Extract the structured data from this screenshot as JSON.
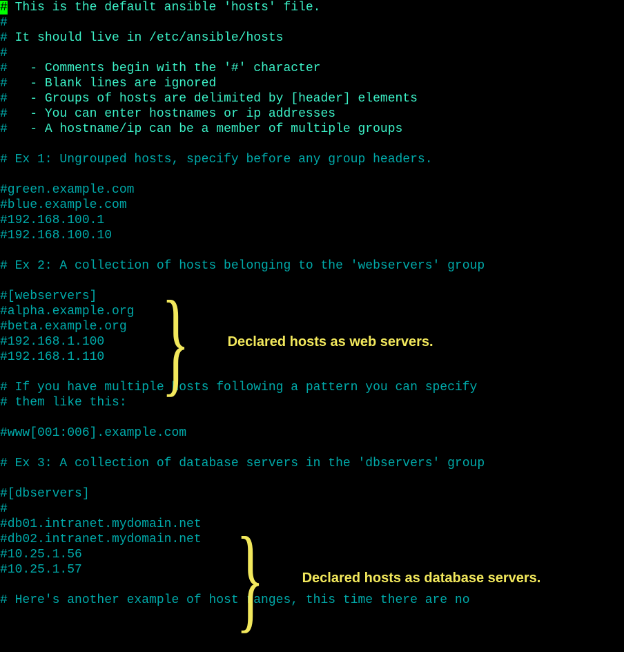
{
  "lines": [
    {
      "cursor": "#",
      "bright": " This is the default ansible 'hosts' file."
    },
    {
      "dim": "#"
    },
    {
      "dim": "#",
      "bright": " It should live in /etc/ansible/hosts"
    },
    {
      "dim": "#"
    },
    {
      "dim": "#",
      "bright": "   - Comments begin with the '#' character"
    },
    {
      "dim": "#",
      "bright": "   - Blank lines are ignored"
    },
    {
      "dim": "#",
      "bright": "   - Groups of hosts are delimited by [header] elements"
    },
    {
      "dim": "#",
      "bright": "   - You can enter hostnames or ip addresses"
    },
    {
      "dim": "#",
      "bright": "   - A hostname/ip can be a member of multiple groups"
    },
    {
      "blank": true
    },
    {
      "dim": "# Ex 1: Ungrouped hosts, specify before any group headers."
    },
    {
      "blank": true
    },
    {
      "dim": "#green.example.com"
    },
    {
      "dim": "#blue.example.com"
    },
    {
      "dim": "#192.168.100.1"
    },
    {
      "dim": "#192.168.100.10"
    },
    {
      "blank": true
    },
    {
      "dim": "# Ex 2: A collection of hosts belonging to the 'webservers' group"
    },
    {
      "blank": true
    },
    {
      "dim": "#[webservers]"
    },
    {
      "dim": "#alpha.example.org"
    },
    {
      "dim": "#beta.example.org"
    },
    {
      "dim": "#192.168.1.100"
    },
    {
      "dim": "#192.168.1.110"
    },
    {
      "blank": true
    },
    {
      "dim": "# If you have multiple hosts following a pattern you can specify"
    },
    {
      "dim": "# them like this:"
    },
    {
      "blank": true
    },
    {
      "dim": "#www[001:006].example.com"
    },
    {
      "blank": true
    },
    {
      "dim": "# Ex 3: A collection of database servers in the 'dbservers' group"
    },
    {
      "blank": true
    },
    {
      "dim": "#[dbservers]"
    },
    {
      "dim": "#"
    },
    {
      "dim": "#db01.intranet.mydomain.net"
    },
    {
      "dim": "#db02.intranet.mydomain.net"
    },
    {
      "dim": "#10.25.1.56"
    },
    {
      "dim": "#10.25.1.57"
    },
    {
      "blank": true
    },
    {
      "dim": "# Here's another example of host ranges, this time there are no"
    }
  ],
  "annotations": {
    "webservers": "Declared hosts as web servers.",
    "dbservers": "Declared hosts as database servers."
  }
}
